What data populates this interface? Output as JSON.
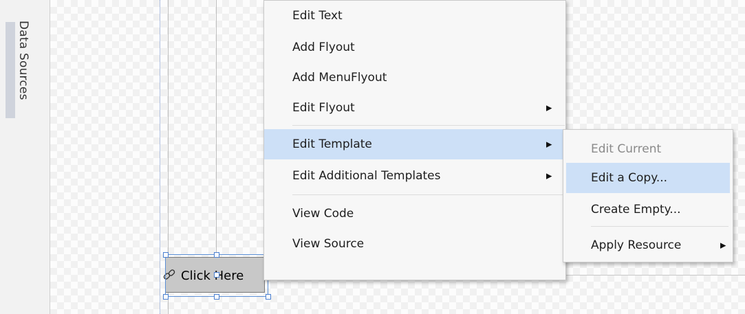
{
  "side_panel": {
    "tab_label": "Data Sources"
  },
  "design_surface": {
    "button_text": "Click Here"
  },
  "context_menu": {
    "items": [
      {
        "label": "Edit Text",
        "submenu": false
      },
      {
        "label": "Add Flyout",
        "submenu": false
      },
      {
        "label": "Add MenuFlyout",
        "submenu": false
      },
      {
        "label": "Edit Flyout",
        "submenu": true
      },
      {
        "label": "Edit Template",
        "submenu": true,
        "highlighted": true
      },
      {
        "label": "Edit Additional Templates",
        "submenu": true
      },
      {
        "label": "View Code",
        "submenu": false
      },
      {
        "label": "View Source",
        "submenu": false
      }
    ]
  },
  "submenu": {
    "items": [
      {
        "label": "Edit Current",
        "enabled": false
      },
      {
        "label": "Edit a Copy...",
        "highlighted": true
      },
      {
        "label": "Create Empty..."
      },
      {
        "label": "Apply Resource",
        "submenu": true
      }
    ]
  },
  "glyphs": {
    "submenu_arrow": "▶"
  },
  "colors": {
    "highlight": "#cde0f7",
    "menu_background": "#f7f7f7",
    "selection": "#4a7fd0"
  }
}
